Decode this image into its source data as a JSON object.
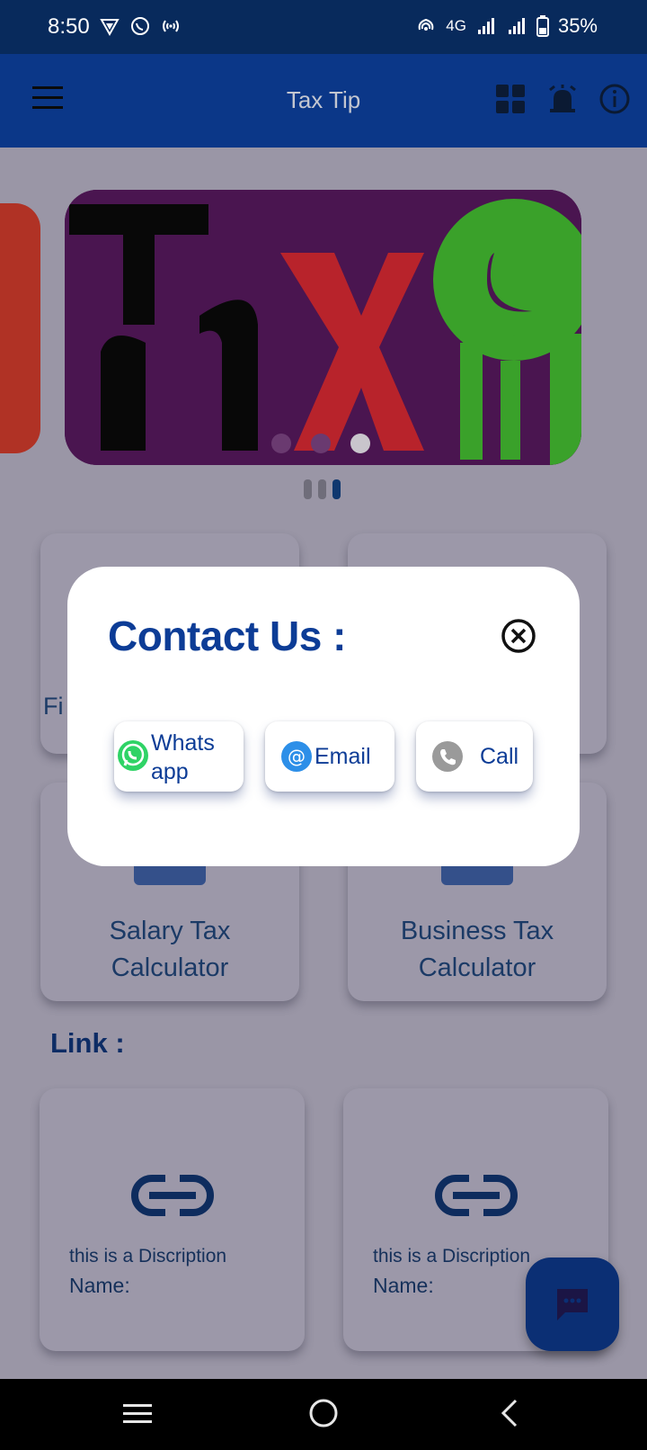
{
  "status_bar": {
    "time": "8:50",
    "network": "4G",
    "battery": "35%"
  },
  "app_bar": {
    "title": "Tax Tip"
  },
  "carousel": {
    "dots": 3,
    "active": 2
  },
  "cards": {
    "partial_label": "Fi",
    "salary_calc": {
      "line1": "Salary Tax",
      "line2": "Calculator"
    },
    "business_calc": {
      "line1": "Business Tax",
      "line2": "Calculator"
    }
  },
  "links": {
    "title": "Link :",
    "items": [
      {
        "description": "this is a Discription",
        "name": "Name:"
      },
      {
        "description": "this is a Discription",
        "name": "Name:"
      }
    ]
  },
  "contact_dialog": {
    "title": "Contact Us :",
    "whatsapp_line1": "Whats",
    "whatsapp_line2": "app",
    "email_label": "Email",
    "call_label": "Call"
  },
  "icons": {
    "menu": "hamburger-icon",
    "grid": "grid-icon",
    "alarm": "alarm-icon",
    "info": "info-icon",
    "close": "close-circle-icon",
    "whatsapp": "whatsapp-icon",
    "email": "at-icon",
    "call": "phone-icon",
    "link": "link-icon",
    "chat": "chat-icon"
  },
  "colors": {
    "primary": "#0b3788",
    "accent": "#0c3c96",
    "overlay": "#9a96a6"
  }
}
